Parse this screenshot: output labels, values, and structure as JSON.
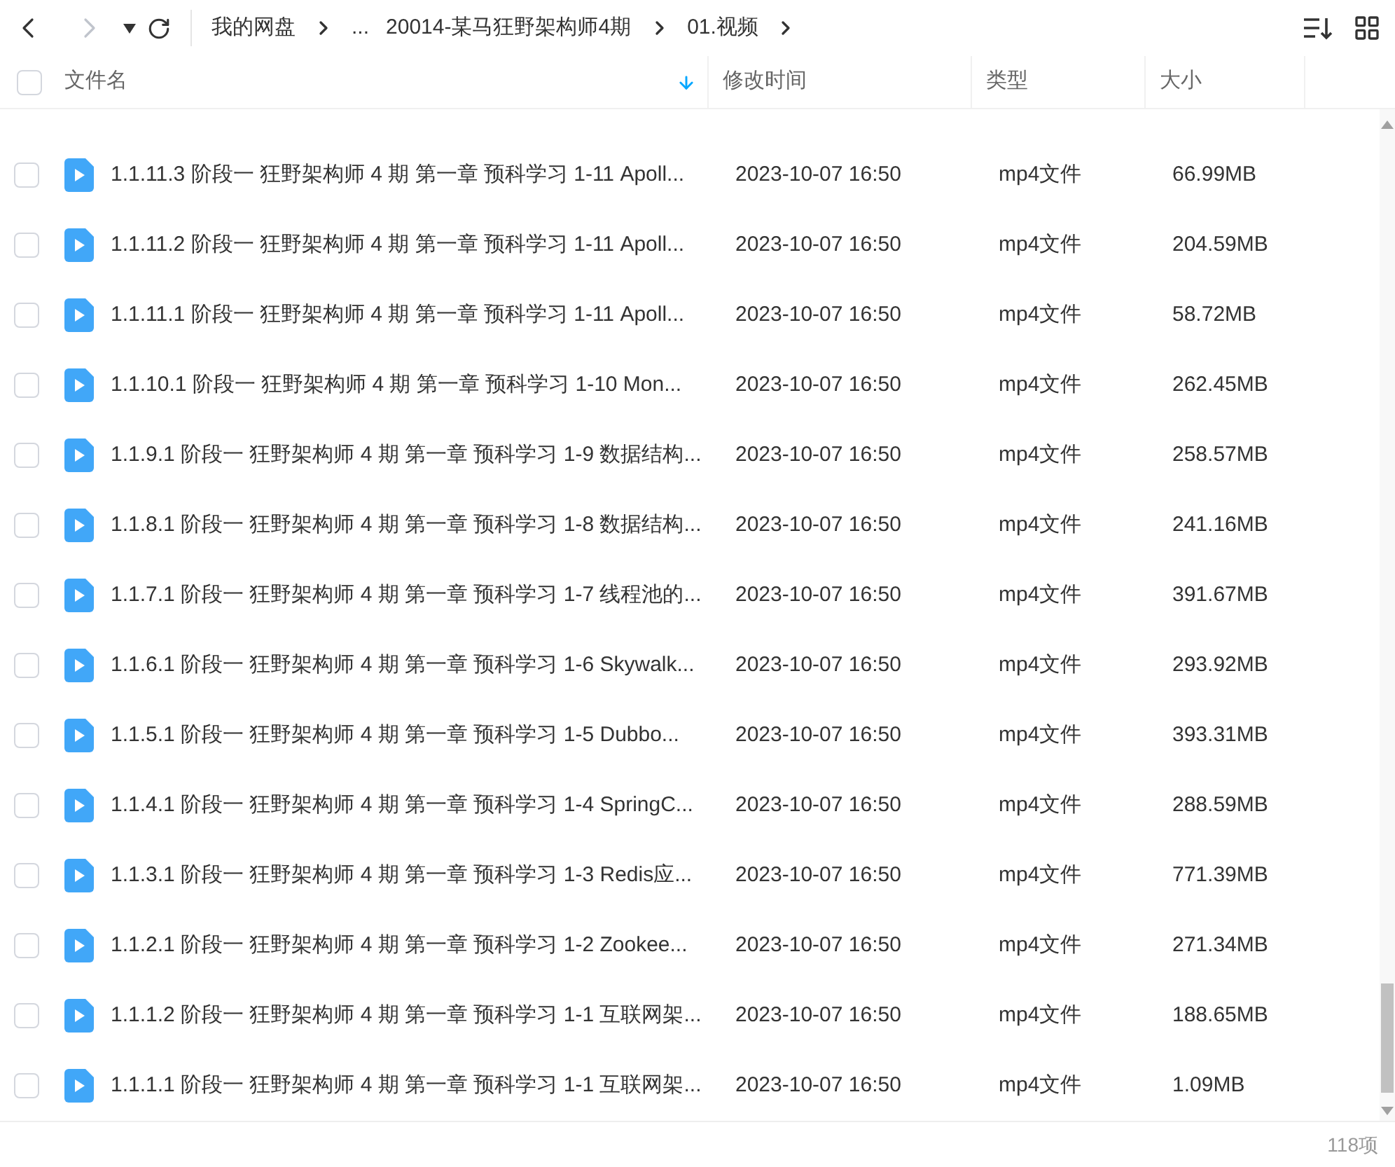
{
  "toolbar": {
    "back_disabled": false,
    "forward_disabled": true
  },
  "breadcrumb": [
    {
      "label": "我的网盘",
      "separator": true
    },
    {
      "label": "...",
      "separator": false
    },
    {
      "label": "20014-某马狂野架构师4期",
      "separator": true
    },
    {
      "label": "01.视频",
      "separator": true
    }
  ],
  "columns": [
    {
      "label": "文件名",
      "sorted": true
    },
    {
      "label": "修改时间",
      "sorted": false
    },
    {
      "label": "类型",
      "sorted": false
    },
    {
      "label": "大小",
      "sorted": false
    }
  ],
  "select_all": {
    "checked": false
  },
  "rows": [
    {
      "name": "1.1.11.3 阶段一 狂野架构师 4 期 第一章 预科学习 1-11 Apoll...",
      "modified": "2023-10-07 16:50",
      "type": "mp4文件",
      "size": "66.99MB",
      "checked": false
    },
    {
      "name": "1.1.11.2 阶段一 狂野架构师 4 期 第一章 预科学习 1-11 Apoll...",
      "modified": "2023-10-07 16:50",
      "type": "mp4文件",
      "size": "204.59MB",
      "checked": false
    },
    {
      "name": "1.1.11.1 阶段一 狂野架构师 4 期 第一章 预科学习 1-11 Apoll...",
      "modified": "2023-10-07 16:50",
      "type": "mp4文件",
      "size": "58.72MB",
      "checked": false
    },
    {
      "name": "1.1.10.1 阶段一 狂野架构师 4 期 第一章 预科学习 1-10 Mon...",
      "modified": "2023-10-07 16:50",
      "type": "mp4文件",
      "size": "262.45MB",
      "checked": false
    },
    {
      "name": "1.1.9.1 阶段一 狂野架构师 4 期 第一章 预科学习 1-9 数据结构...",
      "modified": "2023-10-07 16:50",
      "type": "mp4文件",
      "size": "258.57MB",
      "checked": false
    },
    {
      "name": "1.1.8.1 阶段一 狂野架构师 4 期 第一章 预科学习 1-8 数据结构...",
      "modified": "2023-10-07 16:50",
      "type": "mp4文件",
      "size": "241.16MB",
      "checked": false
    },
    {
      "name": "1.1.7.1 阶段一 狂野架构师 4 期 第一章 预科学习 1-7 线程池的...",
      "modified": "2023-10-07 16:50",
      "type": "mp4文件",
      "size": "391.67MB",
      "checked": false
    },
    {
      "name": "1.1.6.1 阶段一 狂野架构师 4 期 第一章 预科学习 1-6 Skywalk...",
      "modified": "2023-10-07 16:50",
      "type": "mp4文件",
      "size": "293.92MB",
      "checked": false
    },
    {
      "name": "1.1.5.1 阶段一 狂野架构师 4 期 第一章 预科学习 1-5 Dubbo...",
      "modified": "2023-10-07 16:50",
      "type": "mp4文件",
      "size": "393.31MB",
      "checked": false
    },
    {
      "name": "1.1.4.1 阶段一 狂野架构师 4 期 第一章 预科学习 1-4 SpringC...",
      "modified": "2023-10-07 16:50",
      "type": "mp4文件",
      "size": "288.59MB",
      "checked": false
    },
    {
      "name": "1.1.3.1 阶段一 狂野架构师 4 期 第一章 预科学习 1-3 Redis应...",
      "modified": "2023-10-07 16:50",
      "type": "mp4文件",
      "size": "771.39MB",
      "checked": false
    },
    {
      "name": "1.1.2.1 阶段一 狂野架构师 4 期 第一章 预科学习 1-2 Zookee...",
      "modified": "2023-10-07 16:50",
      "type": "mp4文件",
      "size": "271.34MB",
      "checked": false
    },
    {
      "name": "1.1.1.2 阶段一 狂野架构师 4 期 第一章 预科学习 1-1 互联网架...",
      "modified": "2023-10-07 16:50",
      "type": "mp4文件",
      "size": "188.65MB",
      "checked": false
    },
    {
      "name": "1.1.1.1 阶段一 狂野架构师 4 期 第一章 预科学习 1-1 互联网架...",
      "modified": "2023-10-07 16:50",
      "type": "mp4文件",
      "size": "1.09MB",
      "checked": false
    }
  ],
  "status_bar": {
    "count": "118项"
  }
}
